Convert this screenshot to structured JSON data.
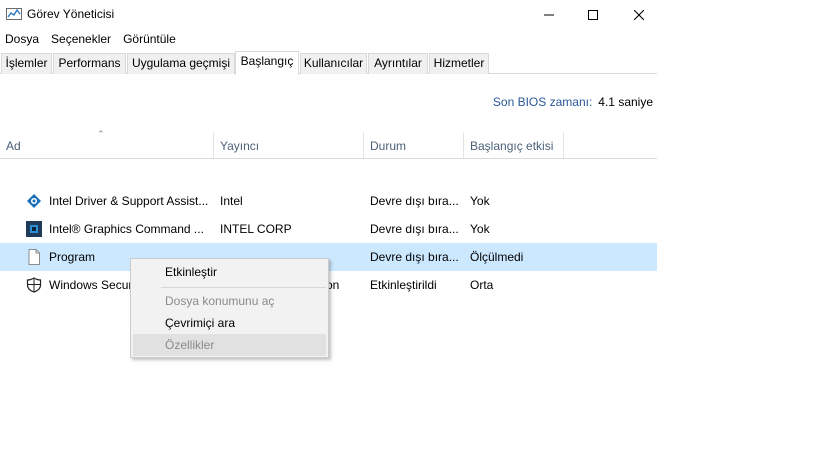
{
  "window": {
    "title": "Görev Yöneticisi",
    "icon": "task-manager-icon"
  },
  "menu": [
    "Dosya",
    "Seçenekler",
    "Görüntüle"
  ],
  "tabs": [
    {
      "label": "İşlemler",
      "active": false
    },
    {
      "label": "Performans",
      "active": false
    },
    {
      "label": "Uygulama geçmişi",
      "active": false
    },
    {
      "label": "Başlangıç",
      "active": true
    },
    {
      "label": "Kullanıcılar",
      "active": false
    },
    {
      "label": "Ayrıntılar",
      "active": false
    },
    {
      "label": "Hizmetler",
      "active": false
    }
  ],
  "bios": {
    "label": "Son BIOS zamanı:",
    "value": "4.1 saniye"
  },
  "columns": {
    "name": "Ad",
    "publisher": "Yayıncı",
    "status": "Durum",
    "impact": "Başlangıç etkisi"
  },
  "rows": [
    {
      "icon": "intel-dsa-icon",
      "name": "Intel Driver & Support Assist...",
      "publisher": "Intel",
      "status": "Devre dışı bıra...",
      "impact": "Yok",
      "selected": false
    },
    {
      "icon": "intel-graphics-icon",
      "name": "Intel® Graphics Command ...",
      "publisher": "INTEL CORP",
      "status": "Devre dışı bıra...",
      "impact": "Yok",
      "selected": false
    },
    {
      "icon": "file-icon",
      "name": "Program",
      "publisher": "",
      "status": "Devre dışı bıra...",
      "impact": "Ölçülmedi",
      "selected": true
    },
    {
      "icon": "windows-security-icon",
      "name": "Windows Secur",
      "publisher": "on",
      "status": "Etkinleştirildi",
      "impact": "Orta",
      "selected": false
    }
  ],
  "context_menu": {
    "items": [
      {
        "label": "Etkinleştir",
        "disabled": false
      },
      {
        "label": "Dosya konumunu aç",
        "disabled": true
      },
      {
        "label": "Çevrimiçi ara",
        "disabled": false
      },
      {
        "label": "Özellikler",
        "disabled": true
      }
    ]
  },
  "colors": {
    "selection": "#cce8ff",
    "header_text": "#4c607a",
    "bios_label": "#2b5797"
  }
}
